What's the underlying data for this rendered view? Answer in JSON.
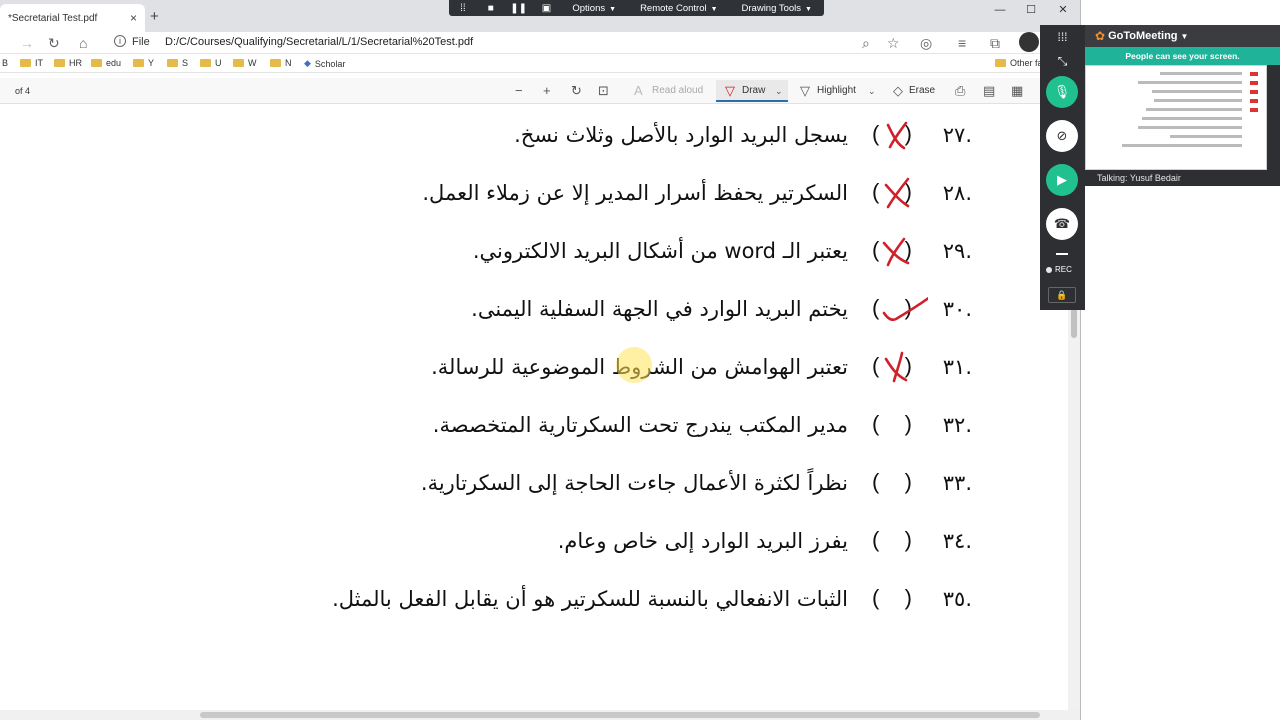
{
  "browser": {
    "tab_title": "*Secretarial Test.pdf",
    "tab_close": "×",
    "new_tab": "+",
    "file_label": "File",
    "url": "D:/C/Courses/Qualifying/Secretarial/L/1/Secretarial%20Test.pdf",
    "bookmarks": [
      "B",
      "IT",
      "HR",
      "edu",
      "Y",
      "S",
      "U",
      "W",
      "N",
      "Scholar"
    ],
    "bookmarks_other": "Other fa"
  },
  "gtm_toolbar": {
    "options": "Options",
    "remote_control": "Remote Control",
    "drawing_tools": "Drawing Tools"
  },
  "pdf_toolbar": {
    "page_of": "of 4",
    "read_aloud": "Read aloud",
    "draw": "Draw",
    "highlight": "Highlight",
    "erase": "Erase"
  },
  "questions": [
    {
      "num": ".٢٧",
      "text": "يسجل البريد الوارد بالأصل وثلاث نسخ.",
      "mark": "x"
    },
    {
      "num": ".٢٨",
      "text": "السكرتير يحفظ أسرار المدير إلا عن زملاء العمل.",
      "mark": "x"
    },
    {
      "num": ".٢٩",
      "text": "يعتبر الـ word من أشكال البريد الالكتروني.",
      "mark": "x"
    },
    {
      "num": ".٣٠",
      "text": "يختم البريد الوارد في الجهة السفلية اليمنى.",
      "mark": "check"
    },
    {
      "num": ".٣١",
      "text": "تعتبر الهوامش من الشروط الموضوعية للرسالة.",
      "mark": "x"
    },
    {
      "num": ".٣٢",
      "text": "مدير المكتب يندرج تحت السكرتارية المتخصصة.",
      "mark": ""
    },
    {
      "num": ".٣٣",
      "text": "نظراً لكثرة الأعمال جاءت الحاجة إلى السكرتارية.",
      "mark": ""
    },
    {
      "num": ".٣٤",
      "text": "يفرز البريد الوارد إلى خاص وعام.",
      "mark": ""
    },
    {
      "num": ".٣٥",
      "text": "الثبات الانفعالي بالنسبة للسكرتير هو أن يقابل الفعل بالمثل.",
      "mark": ""
    }
  ],
  "paren_open": "(",
  "paren_close": ")",
  "gtm_panel": {
    "app_name": "GoToMeeting",
    "notice": "People can see your screen.",
    "talking": "Talking: Yusuf Bedair",
    "rec_label": "REC"
  },
  "colors": {
    "annotation_red": "#d0202a",
    "gtm_green": "#21c18f",
    "gtm_dark": "#2d2f33",
    "notice_teal": "#1fb49a"
  }
}
